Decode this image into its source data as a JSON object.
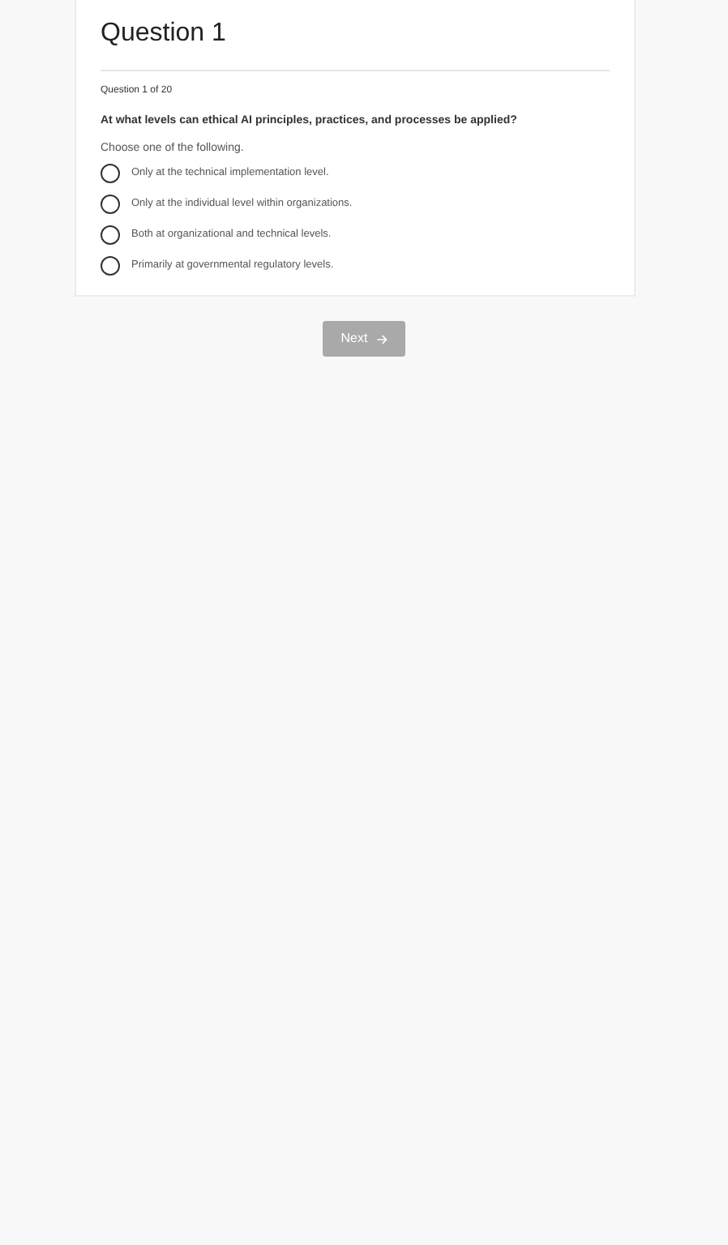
{
  "question": {
    "title": "Question 1",
    "counter": "Question 1 of 20",
    "prompt": "At what levels can ethical AI principles, practices, and processes be applied?",
    "instruction": "Choose one of the following.",
    "options": [
      {
        "label": "Only at the technical implementation level.",
        "selected": false
      },
      {
        "label": "Only at the individual level within organizations.",
        "selected": false
      },
      {
        "label": "Both at organizational and technical levels.",
        "selected": false
      },
      {
        "label": "Primarily at governmental regulatory levels.",
        "selected": false
      }
    ]
  },
  "next_button": {
    "label": "Next",
    "disabled": true
  }
}
